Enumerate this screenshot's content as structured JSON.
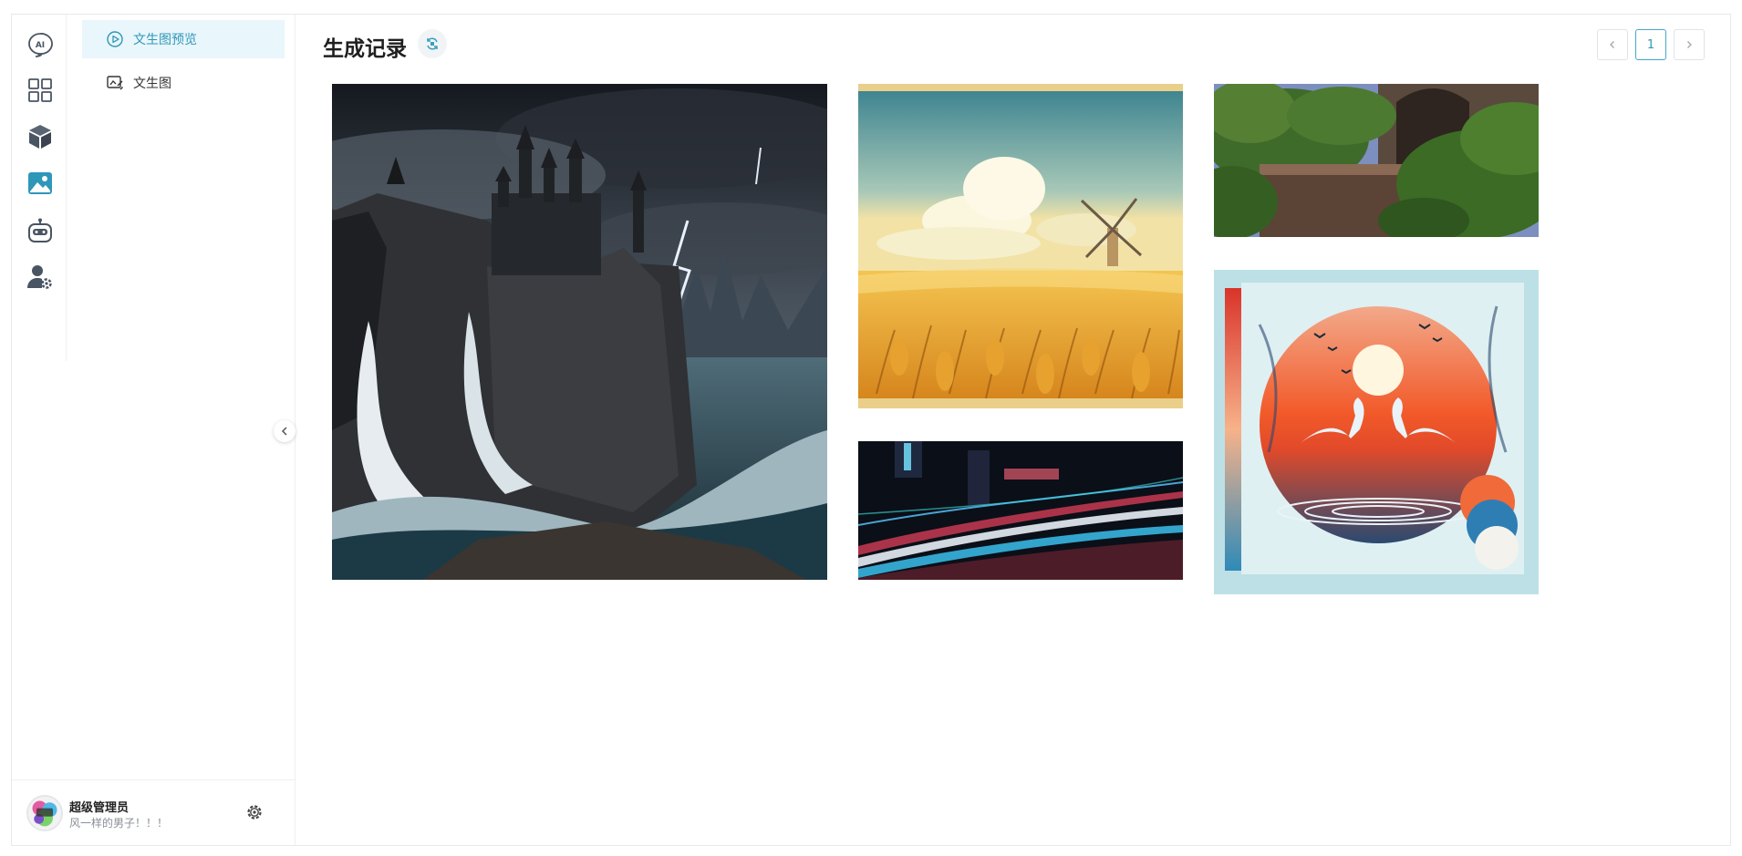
{
  "sidebar": {
    "rail_icons": [
      "ai-chat-icon",
      "apps-grid-icon",
      "cube-icon",
      "image-icon",
      "robot-icon",
      "user-settings-icon"
    ],
    "rail_active": "image-icon",
    "menu": [
      {
        "label": "文生图预览",
        "icon": "play-circle-icon",
        "active": true
      },
      {
        "label": "文生图",
        "icon": "image-edit-icon",
        "active": false
      }
    ]
  },
  "user": {
    "name": "超级管理员",
    "description": "风一样的男子！！！",
    "settings_icon": "gear-icon"
  },
  "main": {
    "title": "生成记录",
    "refresh_icon": "refresh-icon",
    "pagination": {
      "prev_icon": "chevron-left-icon",
      "current_page": "1",
      "next_icon": "chevron-right-icon"
    },
    "images": [
      {
        "name": "castle-storm-image",
        "icon": "castle-storm"
      },
      {
        "name": "wheat-field-windmill-image",
        "icon": "wheat-field-windmill"
      },
      {
        "name": "city-light-trails-image",
        "icon": "light-trails"
      },
      {
        "name": "ruins-greenery-image",
        "icon": "ruins-greenery"
      },
      {
        "name": "swans-sunset-image",
        "icon": "swans-sunset"
      }
    ]
  },
  "colors": {
    "accent": "#2f97b8",
    "active_bg": "#e9f6fb",
    "border": "#eceff3"
  }
}
